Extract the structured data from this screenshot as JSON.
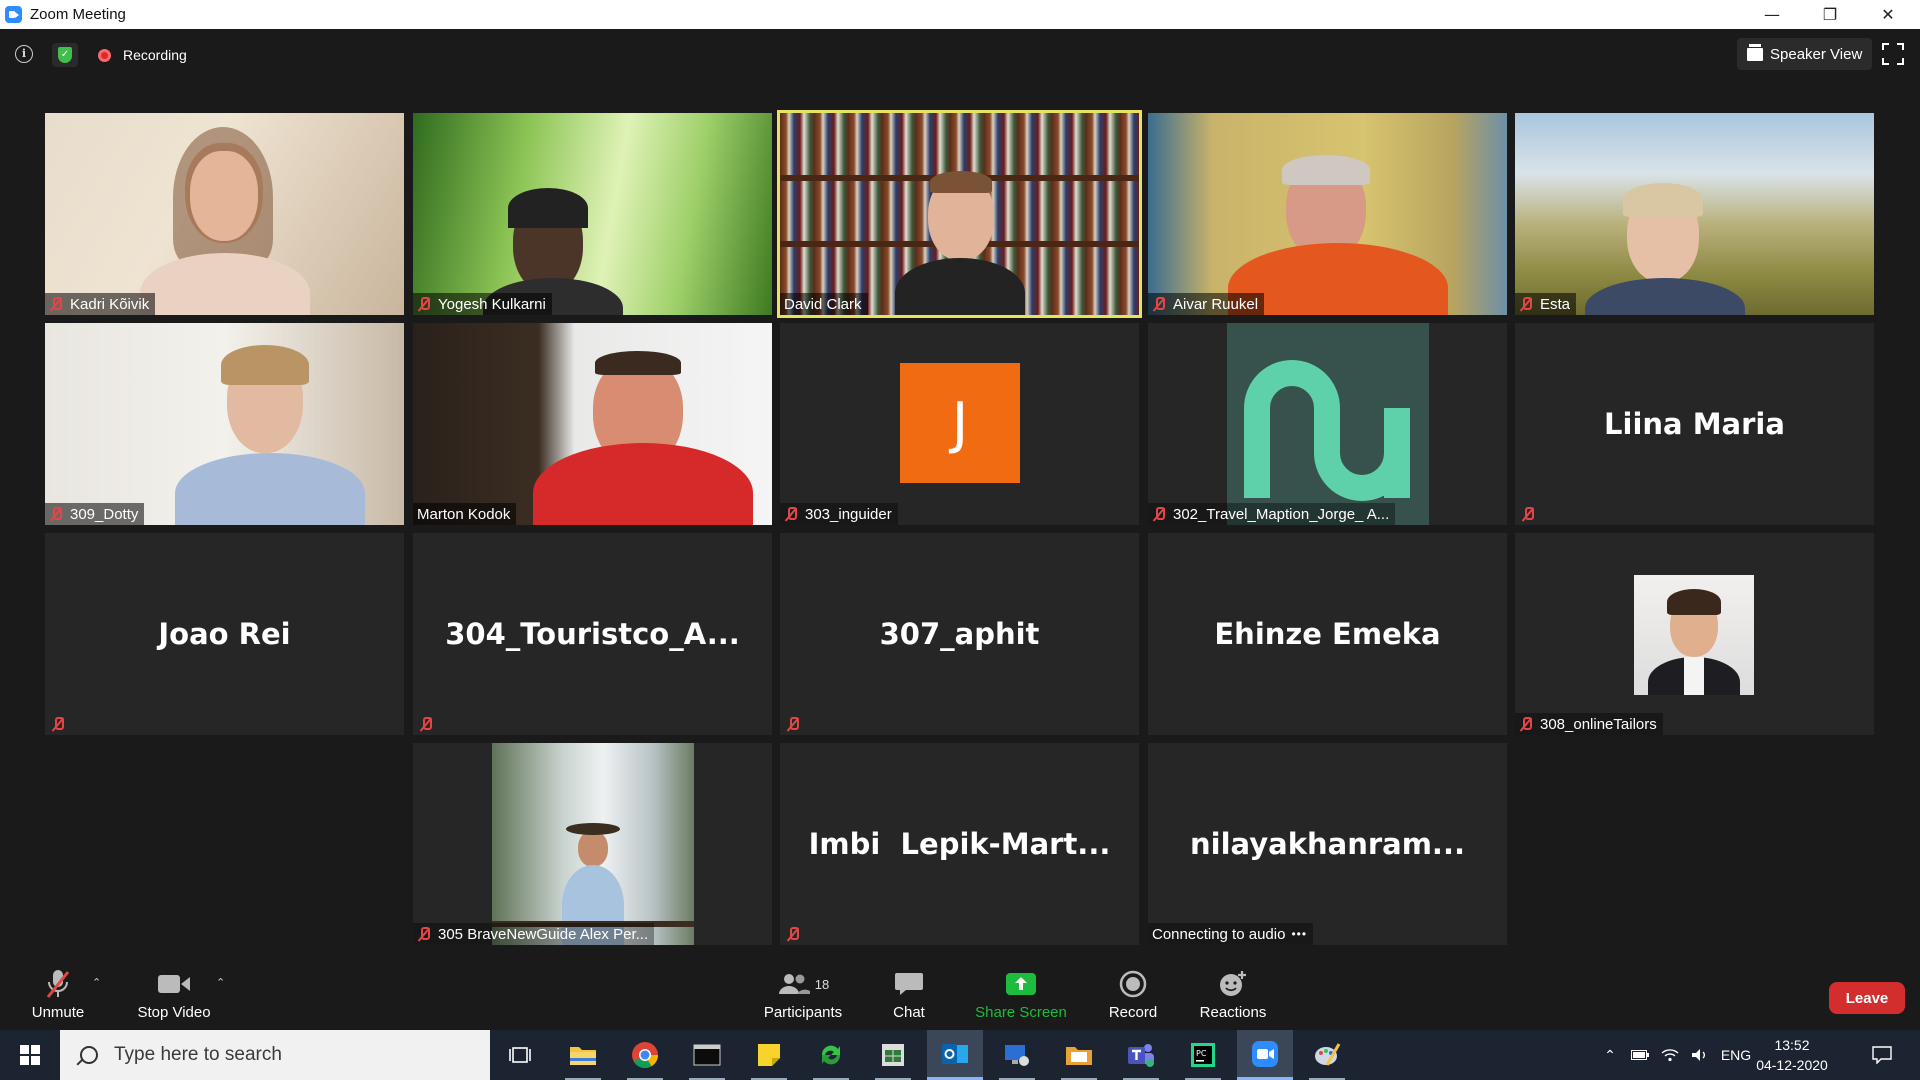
{
  "window": {
    "title": "Zoom Meeting"
  },
  "topbar": {
    "recording_label": "Recording",
    "view_label": "Speaker View"
  },
  "participants": [
    {
      "name": "Kadri Kõivik",
      "muted": true,
      "video": true
    },
    {
      "name": "Yogesh Kulkarni",
      "muted": true,
      "video": true
    },
    {
      "name": "David Clark",
      "muted": false,
      "video": true,
      "active_speaker": true
    },
    {
      "name": "Aivar Ruukel",
      "muted": true,
      "video": true
    },
    {
      "name": "Esta",
      "muted": true,
      "video": true
    },
    {
      "name": "309_Dotty",
      "muted": true,
      "video": true
    },
    {
      "name": "Marton Kodok",
      "muted": false,
      "video": true
    },
    {
      "name": "303_inguider",
      "muted": true,
      "video": false,
      "avatar_letter": "J"
    },
    {
      "name": "302_Travel_Maption_Jorge_ A...",
      "muted": true,
      "video": false,
      "avatar": "logo"
    },
    {
      "name": "Liina Maria",
      "muted": true,
      "video": false
    },
    {
      "name": "Joao Rei",
      "muted": true,
      "video": false
    },
    {
      "name": "304_Touristco_A...",
      "muted": true,
      "video": false
    },
    {
      "name": "307_aphit",
      "muted": true,
      "video": false
    },
    {
      "name": "Ehinze Emeka",
      "muted": false,
      "video": false
    },
    {
      "name": "308_onlineTailors",
      "muted": true,
      "video": false,
      "avatar": "photo"
    },
    {
      "name": "305 BraveNewGuide Alex Per...",
      "muted": true,
      "video": false,
      "avatar": "photo"
    },
    {
      "name": "Imbi  Lepik-Mart...",
      "muted": true,
      "video": false
    },
    {
      "name": "nilayakhanram...",
      "muted": false,
      "video": false,
      "status": "Connecting to audio"
    }
  ],
  "toolbar": {
    "unmute_label": "Unmute",
    "stop_video_label": "Stop Video",
    "participants_label": "Participants",
    "participants_count": "18",
    "chat_label": "Chat",
    "share_label": "Share Screen",
    "record_label": "Record",
    "reactions_label": "Reactions",
    "leave_label": "Leave"
  },
  "taskbar": {
    "search_placeholder": "Type here to search",
    "language": "ENG",
    "time": "13:52",
    "date": "04-12-2020"
  },
  "colors": {
    "accent_share": "#1dbb3e",
    "leave": "#d32e2e",
    "active_border": "#e8e35e",
    "mute_red": "#e04848"
  }
}
